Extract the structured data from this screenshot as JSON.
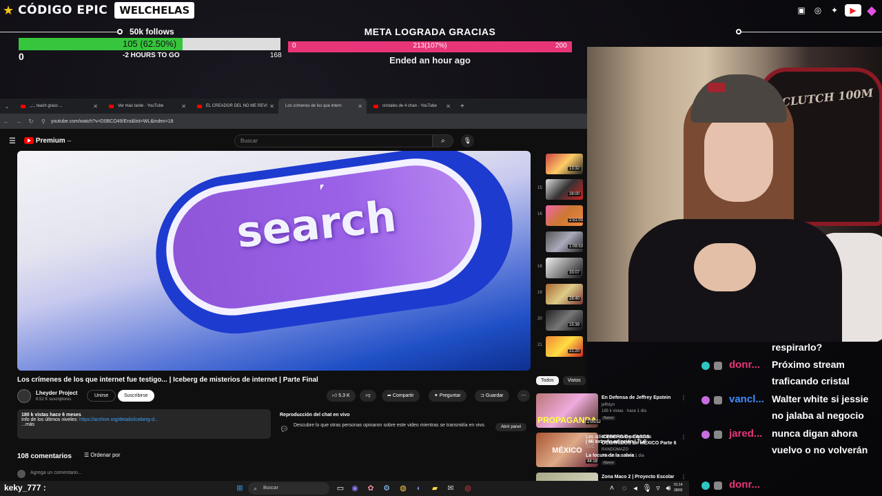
{
  "brand": {
    "name": "CÓDIGO EPIC",
    "tag": "WELCHELAS"
  },
  "goal_follows": {
    "title": "50k follows",
    "progress_text": "105 (62.50%)",
    "progress_fraction": 0.625,
    "min": "0",
    "countdown": "-2 HOURS TO GO",
    "max": "168",
    "bar_color": "#36c53c"
  },
  "goal_meta": {
    "title": "META LOGRADA GRACIAS",
    "min": "0",
    "progress_text": "213(107%)",
    "max": "200",
    "status": "Ended an hour ago",
    "bar_color": "#e8357a"
  },
  "browser": {
    "tabs": [
      {
        "label": ",,:,, teach grass ... ",
        "active": false
      },
      {
        "label": "Ver más tarde - YouTube",
        "active": false
      },
      {
        "label": "EL CREADOR DEL NO ME REVI",
        "active": false
      },
      {
        "label": "Los crimenes de los que intern",
        "active": true
      },
      {
        "label": "cristales de 4 chan - YouTube",
        "active": false
      }
    ],
    "url": "youtube.com/watch?v=D0BCO49/Ero&list=WL&index=18"
  },
  "youtube": {
    "logo": "Premium",
    "logo_sup": "MX",
    "search_placeholder": "Buscar",
    "video_word": "search",
    "video_title": "Los crímenes de los que internet fue testigo... | Iceberg de misterios de internet | Parte Final",
    "channel": {
      "name": "Lheyder Project",
      "subs": "8.52 K suscriptores"
    },
    "join_label": "Unirse",
    "subscribe_label": "Suscribirse",
    "likes": "5.3 K",
    "share_label": "Compartir",
    "ask_label": "Preguntar",
    "save_label": "Guardar",
    "description": {
      "line1": "180 k vistas  hace 6 meses",
      "line2_prefix": "Info de los últimos niveles: ",
      "link": "https://archive.org/details/iceberg-d...",
      "more": "...más"
    },
    "chat_replay": {
      "title": "Reproducción del chat en vivo",
      "desc": "Descubre lo que otras personas opinaron sobre este video mientras se transmitía en vivo.",
      "open": "Abrir panel"
    },
    "comments_count": "108 comentarios",
    "order_label": "Ordenar por",
    "add_comment": "Agrega un comentario...",
    "playlist": [
      {
        "num": "",
        "dur": "13:32"
      },
      {
        "num": "15",
        "dur": "28:00"
      },
      {
        "num": "16",
        "dur": "2:51:03"
      },
      {
        "num": "",
        "dur": "1:08:53"
      },
      {
        "num": "18",
        "dur": "33:07"
      },
      {
        "num": "19",
        "dur": "28:40"
      },
      {
        "num": "20",
        "dur": "15:39"
      },
      {
        "num": "21",
        "dur": "21:20"
      }
    ],
    "playlist_panel": {
      "line1": "Las adicciones más peligrosas",
      "line2": "| Mi extraña adicción | TLC",
      "line3": "TLC",
      "line4": "La locura de la salvia"
    },
    "chips": {
      "all": "Todos",
      "seen": "Vistos"
    },
    "recommendations": [
      {
        "title": "En Defensa de Jeffrey Epstein",
        "channel": "jeffstyn",
        "meta": "185 k vistas · hace 1 día",
        "badge": "Nuevo",
        "dur": "1:05:52",
        "thumb_text": "PROPAGANDA"
      },
      {
        "title": "ICEBERG De CASOS OCURRIDOS En MÉXICO Parte 6",
        "channel": "RANDOMAZO",
        "meta": "86 k vistas · hace 1 día",
        "badge": "Nuevo",
        "dur": "44:18",
        "thumb_text": "MÉXICO"
      },
      {
        "title": "Zona Maco 2 | Proyecto Escolar",
        "channel": "",
        "meta": "",
        "badge": "",
        "dur": "",
        "thumb_text": ""
      }
    ]
  },
  "webcam": {
    "chair_text": "CLUTCH 100M"
  },
  "chat": {
    "lines": [
      {
        "user": "",
        "text": "respirarlo?"
      },
      {
        "user": "donr...",
        "user_color": "#e8357a",
        "text": "Próximo stream"
      },
      {
        "user": "",
        "text": "traficando cristal"
      },
      {
        "user": "vancl...",
        "user_color": "#3f8cff",
        "text": "Walter white si jessie"
      },
      {
        "user": "",
        "text": "no jalaba al negocio"
      },
      {
        "user": "jared...",
        "user_color": "#e8357a",
        "text": "nunca digan ahora"
      },
      {
        "user": "",
        "text": "vuelvo o no volverán"
      },
      {
        "user": "donr...",
        "user_color": "#e8357a",
        "text": ""
      }
    ],
    "input_user": "keky_777 :"
  },
  "taskbar": {
    "search": "Buscar",
    "time": "01:14",
    "date": "28/02"
  }
}
